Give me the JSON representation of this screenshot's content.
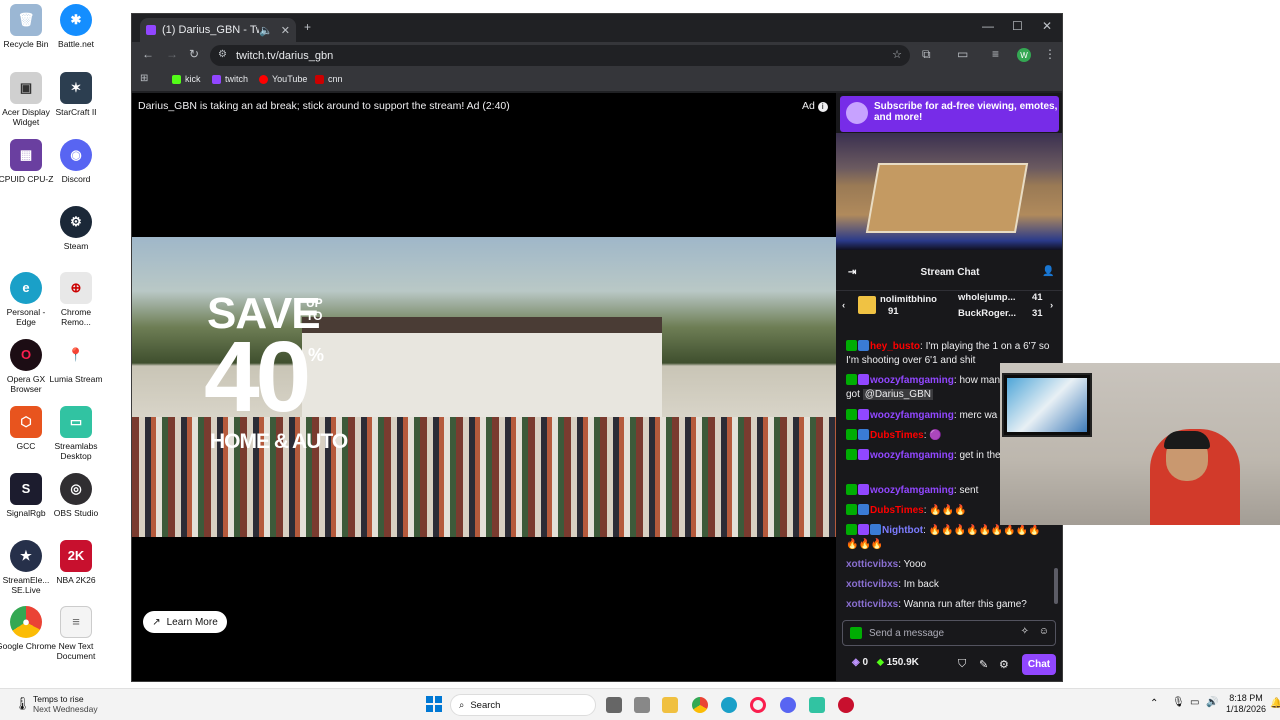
{
  "desktop": {
    "icons": [
      {
        "label": "Recycle Bin",
        "icon": "recycle-bin-icon"
      },
      {
        "label": "Battle.net",
        "icon": "battlenet-icon"
      },
      {
        "label": "Acer Display Widget",
        "icon": "acer-display-icon"
      },
      {
        "label": "StarCraft II",
        "icon": "starcraft-icon"
      },
      {
        "label": "CPUID CPU-Z",
        "icon": "cpuz-icon"
      },
      {
        "label": "Discord",
        "icon": "discord-icon"
      },
      {
        "label": "Steam",
        "icon": "steam-icon"
      },
      {
        "label": "Personal - Edge",
        "icon": "edge-icon"
      },
      {
        "label": "Chrome Remo...",
        "icon": "chrome-remote-icon"
      },
      {
        "label": "Opera GX Browser",
        "icon": "opera-gx-icon"
      },
      {
        "label": "Lumia Stream",
        "icon": "lumia-stream-icon"
      },
      {
        "label": "GCC",
        "icon": "gcc-icon"
      },
      {
        "label": "Streamlabs Desktop",
        "icon": "streamlabs-icon"
      },
      {
        "label": "SignalRgb",
        "icon": "signalrgb-icon"
      },
      {
        "label": "OBS Studio",
        "icon": "obs-icon"
      },
      {
        "label": "StreamEle... SE.Live",
        "icon": "streamelements-icon"
      },
      {
        "label": "NBA 2K26",
        "icon": "nba2k26-icon"
      },
      {
        "label": "Google Chrome",
        "icon": "chrome-icon"
      },
      {
        "label": "New Text Document",
        "icon": "text-document-icon"
      }
    ]
  },
  "browser": {
    "tab_title": "(1) Darius_GBN - Twitch",
    "url": "twitch.tv/darius_gbn",
    "profile_initial": "W",
    "bookmarks": [
      {
        "label": "kick",
        "color": "#53fc18"
      },
      {
        "label": "twitch",
        "color": "#9146ff"
      },
      {
        "label": "YouTube",
        "color": "#ff0000"
      },
      {
        "label": "cnn",
        "color": "#cc0000"
      }
    ]
  },
  "player": {
    "ad_message": "Darius_GBN is taking an ad break; stick around to support the stream! Ad (2:40)",
    "ad_badge": "Ad",
    "ad_creative": {
      "save": "SAVE",
      "up_to_line1": "UP",
      "up_to_line2": "TO",
      "amount": "40",
      "percent": "%",
      "tagline": "HOME & AUTO"
    },
    "learn_more": "Learn More"
  },
  "sidebar": {
    "subscribe_banner": "Subscribe for ad-free viewing, emotes, and more!",
    "chat_title": "Stream Chat",
    "leaderboard": [
      {
        "name": "nolimitbhino",
        "count": "91"
      },
      {
        "name": "wholejump...",
        "count": "41"
      },
      {
        "name": "BuckRoger...",
        "count": "31"
      }
    ],
    "messages": [
      {
        "user": "hey_busto",
        "user_color": "#ff0000",
        "text": ": I'm playing the 1 on a 6'7 so I'm shooting over 6'1 and shit"
      },
      {
        "user": "woozyfamgaming",
        "user_color": "#9147ff",
        "text": ": how many",
        "text2": "got",
        "mention": "@Darius_GBN"
      },
      {
        "user": "woozyfamgaming",
        "user_color": "#9147ff",
        "text": ": merc wa"
      },
      {
        "user": "DubsTimes",
        "user_color": "#ff0000",
        "text": ":"
      },
      {
        "user": "woozyfamgaming",
        "user_color": "#9147ff",
        "text": ": get in the discord"
      },
      {
        "user": "woozyfamgaming",
        "user_color": "#9147ff",
        "text": ": sent"
      },
      {
        "user": "DubsTimes",
        "user_color": "#ff0000",
        "text": ":"
      },
      {
        "user": "Nightbot",
        "user_color": "#7c7cff",
        "text": ":"
      },
      {
        "user": "xotticvibxs",
        "user_color": "#8a6fd1",
        "text": ": Yooo"
      },
      {
        "user": "xotticvibxs",
        "user_color": "#8a6fd1",
        "text": ": Im back"
      },
      {
        "user": "xotticvibxs",
        "user_color": "#8a6fd1",
        "text": ": Wanna run after this game?"
      }
    ],
    "input_placeholder": "Send a message",
    "points": "0",
    "bits": "150.9K",
    "chat_button": "Chat"
  },
  "taskbar": {
    "weather_title": "Temps to rise",
    "weather_sub": "Next Wednesday",
    "search_label": "Search",
    "time": "8:18 PM",
    "date": "1/18/2026"
  },
  "colors": {
    "twitch_purple": "#9147ff",
    "accent": "#772ce8"
  }
}
